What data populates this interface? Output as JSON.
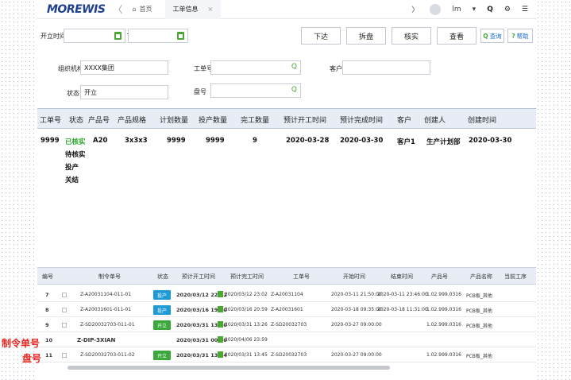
{
  "nav": {
    "logo": "MOREWIS",
    "back": "〈",
    "home_label": "首页",
    "active_tab": "工单信息",
    "close": "×",
    "user": "lm"
  },
  "toolbar": {
    "open_time_label": "开立时间",
    "btn_dispatch": "下达",
    "btn_split": "拆盘",
    "btn_verify": "核实",
    "btn_view": "查看",
    "btn_query": "查询",
    "btn_help": "帮助"
  },
  "form": {
    "org_label": "组织机构",
    "org_value": "XXXX集团",
    "order_no_label": "工单号",
    "customer_label": "客户",
    "status_label": "状态",
    "status_value": "开立",
    "disk_label": "盘号"
  },
  "main_table": {
    "headers": [
      "工单号",
      "状态",
      "产品号",
      "产品规格",
      "计划数量",
      "投产数量",
      "完工数量",
      "预计开工时间",
      "预计完成时间",
      "客户",
      "创建人",
      "创建时间"
    ],
    "row": {
      "order_no": "9999",
      "status_options": [
        "已核实",
        "待核实",
        "投产",
        "关结"
      ],
      "product_no": "A20",
      "spec": "3x3x3",
      "plan_qty": "9999",
      "prod_qty": "9999",
      "done_qty": "9",
      "start": "2020-03-28",
      "finish": "2020-03-30",
      "customer": "客户1",
      "creator": "生产计划部",
      "created": "2020-03-30"
    }
  },
  "grid": {
    "headers": [
      "编号",
      "制令单号",
      "状态",
      "预计开工时间",
      "预计完工时间",
      "工单号",
      "开始时间",
      "结束时间",
      "产品号",
      "产品名称",
      "当前工序"
    ],
    "rows": [
      {
        "no": "7",
        "order": "Z-A20031104-011-01",
        "status": "投产",
        "plan_start": "2020/03/12 22:02",
        "plan_end": "2020/03/12 23:02",
        "work_order": "Z-A20031104",
        "start": "2020-03-11 21:50:00",
        "end": "2020-03-11 23:46:00",
        "product": "1.02.999.0316",
        "name": "PCB板_其他"
      },
      {
        "no": "8",
        "order": "Z-A20031601-011-01",
        "status": "投产",
        "plan_start": "2020/03/16 19:00",
        "plan_end": "2020/03/16 20:59",
        "work_order": "Z-A20031601",
        "start": "2020-03-18 09:35:00",
        "end": "2020-03-18 11:31:00",
        "product": "1.02.999.0316",
        "name": "PCB板_其他"
      },
      {
        "no": "9",
        "order": "Z-SD20032703-011-01",
        "status": "开立",
        "plan_start": "2020/03/31 13:10",
        "plan_end": "2020/03/31 13:26",
        "work_order": "Z-SD20032703",
        "start": "2020-03-27 09:00:00",
        "end": "",
        "product": "1.02.999.0316",
        "name": "PCB板_其他"
      },
      {
        "no": "10",
        "order": "Z-DIP-3XIAN",
        "status": "",
        "plan_start": "2020/03/31 00:00",
        "plan_end": "2020/04/06 23:59",
        "work_order": "",
        "start": "",
        "end": "",
        "product": "",
        "name": ""
      },
      {
        "no": "11",
        "order": "Z-SD20032703-011-02",
        "status": "开立",
        "plan_start": "2020/03/31 13:24",
        "plan_end": "2020/03/31 13:45",
        "work_order": "Z-SD20032703",
        "start": "2020-03-27 09:00:00",
        "end": "",
        "product": "1.02.999.0316",
        "name": "PCB板_其他"
      }
    ]
  },
  "annotations": {
    "order_label": "制令单号",
    "disk_label": "盘号"
  },
  "colors": {
    "accent_blue": "#1a6ad6",
    "status_green": "#2aa32a",
    "badge_blue": "#1e9ad6",
    "badge_green": "#3aa83a",
    "annotation_red": "#e8261f"
  }
}
